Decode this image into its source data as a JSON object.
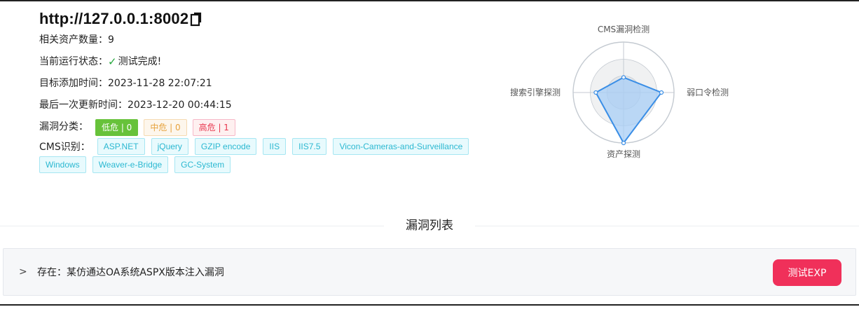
{
  "target": {
    "url": "http://127.0.0.1:8002",
    "assets_label": "相关资产数量：",
    "assets_count": "9",
    "status_label": "当前运行状态：",
    "status_value": "测试完成!",
    "added_label": "目标添加时间：",
    "added_time": "2023-11-28 22:07:21",
    "updated_label": "最后一次更新时间：",
    "updated_time": "2023-12-20 00:44:15",
    "vuln_label": "漏洞分类：",
    "vuln_badges": {
      "low": "低危 | 0",
      "mid": "中危 | 0",
      "high": "高危 | 1"
    },
    "cms_label": "CMS识别：",
    "cms_tags": [
      "ASP.NET",
      "jQuery",
      "GZIP encode",
      "IIS",
      "IIS7.5",
      "Vicon-Cameras-and-Surveillance",
      "Windows",
      "Weaver-e-Bridge",
      "GC-System"
    ]
  },
  "radar": {
    "indicators": [
      "CMS漏洞检测",
      "弱口令检测",
      "资产探测",
      "搜索引擎探测"
    ],
    "values": [
      0.3,
      0.75,
      1.0,
      0.55
    ],
    "colors": {
      "fill": "#a8cdf5",
      "line": "#3a8ee6"
    }
  },
  "section": {
    "title": "漏洞列表"
  },
  "vuln_list": [
    {
      "text": "存在：某仿通达OA系统ASPX版本注入漏洞",
      "button": "测试EXP"
    }
  ],
  "colors": {
    "exp_button": "#f0305a",
    "ok": "#22a63a",
    "cms_tag": "#2bb8d1"
  }
}
